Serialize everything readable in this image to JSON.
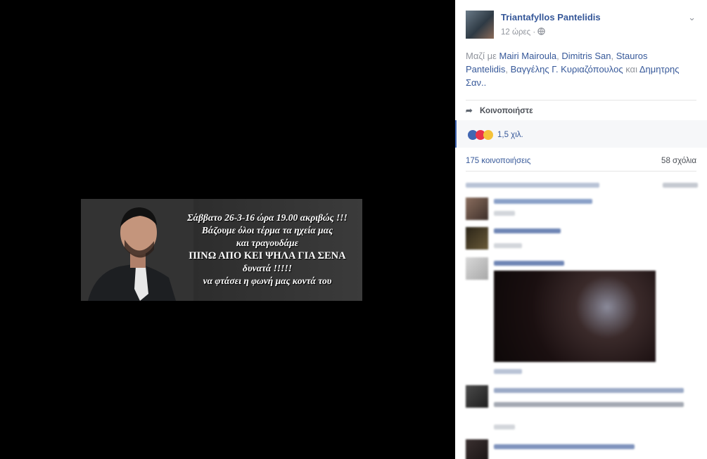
{
  "banner": {
    "lines": [
      "Σάββατο 26-3-16 ώρα 19.00 ακριβώς !!!",
      "Βάζουμε όλοι τέρμα τα ηχεία μας",
      "και τραγουδάμε",
      "ΠΙΝΩ ΑΠΟ ΚΕΙ ΨΗΛΑ ΓΙΑ ΣΕΝΑ",
      "δυνατά !!!!!",
      "να φτάσει η φωνή μας κοντά του"
    ]
  },
  "post": {
    "author": "Triantafyllos Pantelidis",
    "time": "12 ώρες",
    "with_prefix": "Μαζί με",
    "tags": [
      "Mairi Mairoula",
      "Dimitris San",
      "Stauros Pantelidis",
      "Βαγγέλης Γ. Κυριαζόπουλος"
    ],
    "tags_sep": ",",
    "tags_and": "και",
    "tags_last": "Δημητρης Σαν..",
    "share_label": "Κοινοποιήστε",
    "reactions_count": "1,5 χιλ.",
    "shares": "175 κοινοποιήσεις",
    "comments": "58 σχόλια"
  },
  "colors": {
    "link": "#365899",
    "muted": "#90949c",
    "like": "#4267b2",
    "love": "#e9344a",
    "sad": "#f5c23a"
  },
  "icons": {
    "privacy": "globe-icon",
    "menu": "chevron-down-icon",
    "share": "share-arrow-icon"
  }
}
